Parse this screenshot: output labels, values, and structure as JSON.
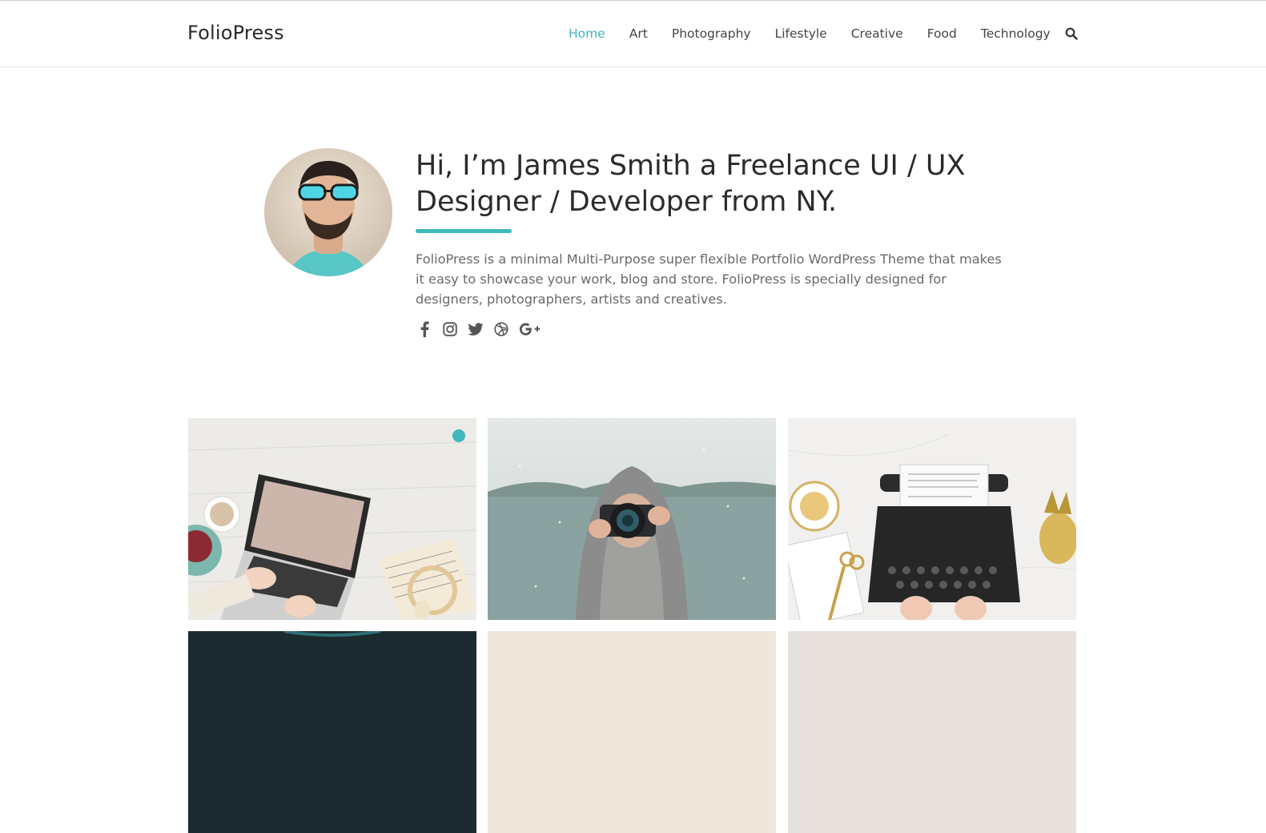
{
  "site": {
    "logo": "FolioPress"
  },
  "nav": {
    "items": [
      {
        "label": "Home",
        "active": true
      },
      {
        "label": "Art"
      },
      {
        "label": "Photography"
      },
      {
        "label": "Lifestyle"
      },
      {
        "label": "Creative"
      },
      {
        "label": "Food"
      },
      {
        "label": "Technology"
      }
    ],
    "search_icon": "search-icon"
  },
  "hero": {
    "title_line1": "Hi, I’m James Smith a Freelance UI / UX",
    "title_line2": "Designer / Developer from NY.",
    "description": "FolioPress is a minimal Multi-Purpose super flexible Portfolio WordPress Theme that makes it easy to showcase your work, blog and store. FolioPress is specially designed for designers, photographers, artists and creatives.",
    "socials": [
      "facebook-icon",
      "instagram-icon",
      "twitter-icon",
      "dribbble-icon",
      "google-plus-icon"
    ]
  },
  "portfolio": {
    "tiles": [
      {
        "subject": "laptop-on-desk-image"
      },
      {
        "subject": "photographer-in-snow-image"
      },
      {
        "subject": "typewriter-on-marble-image"
      },
      {
        "subject": "dark-tile-image"
      },
      {
        "subject": "beige-tile-image"
      },
      {
        "subject": "light-tile-image"
      }
    ]
  },
  "colors": {
    "accent": "#3fb7bd",
    "text": "#2b2b2b",
    "muted": "#6a6a6a"
  }
}
